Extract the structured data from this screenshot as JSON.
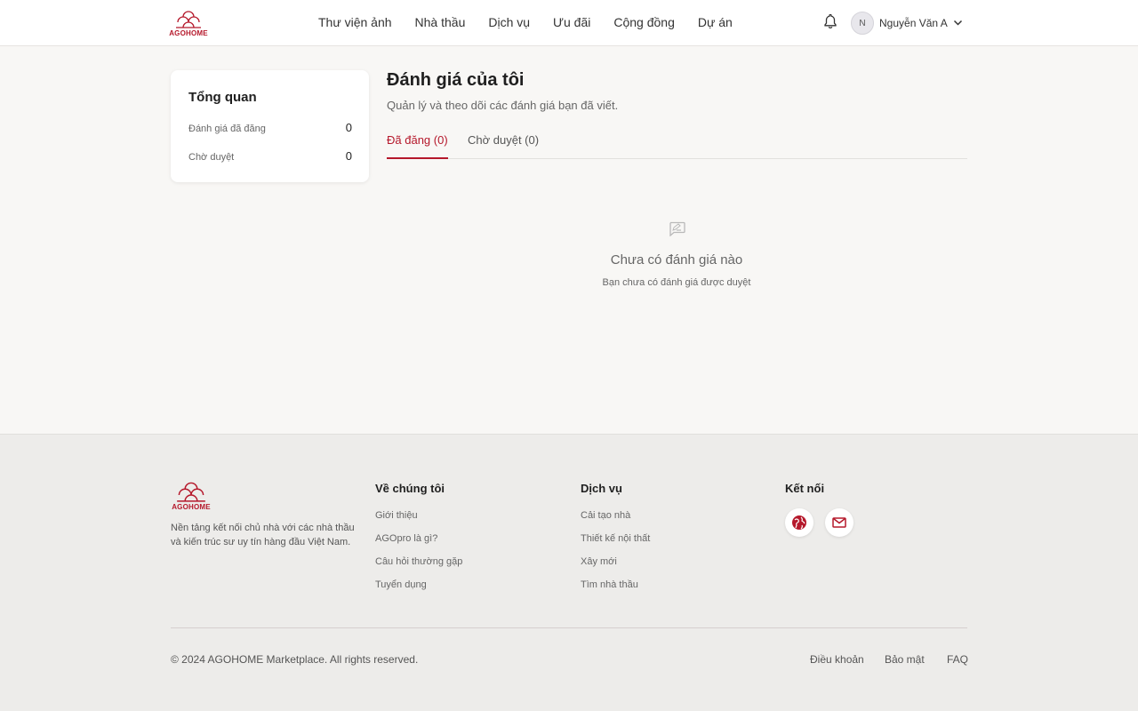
{
  "brand": {
    "name": "AGOHOME",
    "color": "#b5182b"
  },
  "header": {
    "nav": [
      "Thư viện ảnh",
      "Nhà thầu",
      "Dịch vụ",
      "Ưu đãi",
      "Cộng đồng",
      "Dự án"
    ],
    "user": {
      "initial": "N",
      "name": "Nguyễn Văn A"
    }
  },
  "overview": {
    "title": "Tổng quan",
    "rows": [
      {
        "label": "Đánh giá đã đăng",
        "value": "0"
      },
      {
        "label": "Chờ duyệt",
        "value": "0"
      }
    ]
  },
  "main": {
    "title": "Đánh giá của tôi",
    "subtitle": "Quản lý và theo dõi các đánh giá bạn đã viết.",
    "tabs": [
      {
        "label": "Đã đăng (0)",
        "active": true
      },
      {
        "label": "Chờ duyệt (0)",
        "active": false
      }
    ],
    "empty": {
      "title": "Chưa có đánh giá nào",
      "subtitle": "Bạn chưa có đánh giá được duyệt"
    }
  },
  "footer": {
    "description": "Nền tảng kết nối chủ nhà với các nhà thầu và kiến trúc sư uy tín hàng đầu Việt Nam.",
    "about": {
      "heading": "Về chúng tôi",
      "links": [
        "Giới thiệu",
        "AGOpro là gì?",
        "Câu hỏi thường gặp",
        "Tuyển dụng"
      ]
    },
    "services": {
      "heading": "Dịch vụ",
      "links": [
        "Cải tạo nhà",
        "Thiết kế nội thất",
        "Xây mới",
        "Tìm nhà thầu"
      ]
    },
    "connect": {
      "heading": "Kết nối",
      "icons": [
        "globe-icon",
        "mail-icon"
      ]
    },
    "copyright": "© 2024 AGOHOME Marketplace. All rights reserved.",
    "legal": [
      "Điều khoản",
      "Bảo mật",
      "FAQ"
    ]
  }
}
